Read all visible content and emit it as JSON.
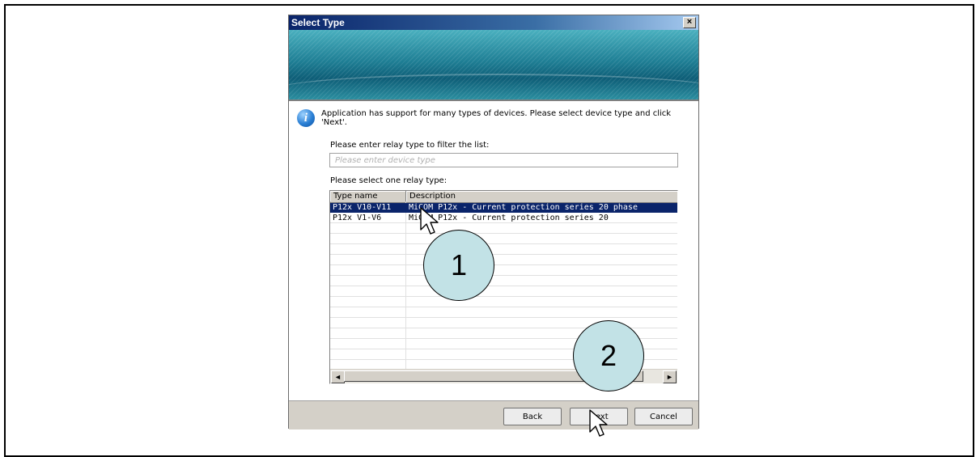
{
  "dialog": {
    "title": "Select Type",
    "close_glyph": "×",
    "info_icon_glyph": "i",
    "info_text": "Application has support for many types of devices. Please select device type and click 'Next'."
  },
  "filter": {
    "label": "Please enter relay type to filter the list:",
    "placeholder": "Please enter device type",
    "value": ""
  },
  "list": {
    "label": "Please select one relay type:",
    "columns": [
      "Type name",
      "Description"
    ],
    "rows": [
      {
        "type": "P12x V10-V11",
        "description": "MiCOM P12x - Current protection series 20 phase",
        "selected": true
      },
      {
        "type": "P12x V1-V6",
        "description": "MiCOM P12x - Current protection series 20",
        "selected": false
      }
    ],
    "scroll_left_glyph": "◄",
    "scroll_right_glyph": "►"
  },
  "buttons": {
    "back": "Back",
    "next": "Next",
    "cancel": "Cancel"
  },
  "callouts": {
    "one": "1",
    "two": "2"
  },
  "icons": {
    "info": "info-icon",
    "close": "close-icon",
    "cursor": "arrow-cursor-icon"
  },
  "colors": {
    "selection": "#0a246a",
    "callout_fill": "#c2e2e6",
    "title_bar": "#0a246a"
  }
}
